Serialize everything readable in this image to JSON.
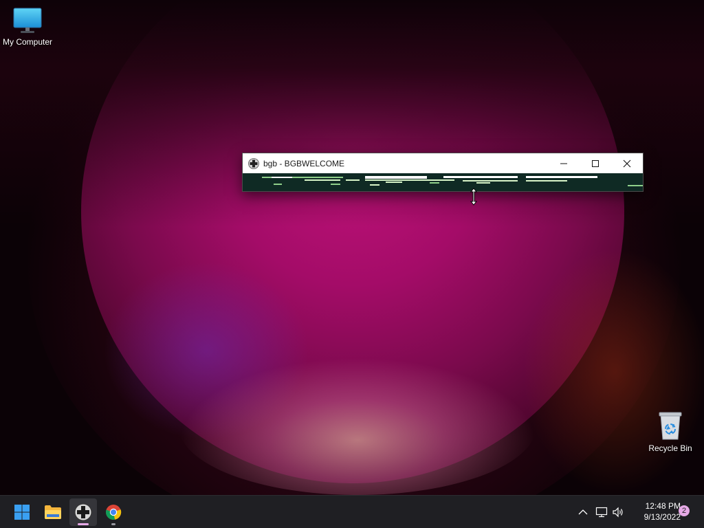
{
  "desktop": {
    "icons": [
      {
        "label": "My Computer",
        "icon": "monitor-icon"
      },
      {
        "label": "Recycle Bin",
        "icon": "recycle-bin-icon"
      }
    ]
  },
  "window": {
    "title": "bgb - BGBWELCOME",
    "icon": "gamepad-dpad-icon",
    "buttons": [
      "minimize-icon",
      "maximize-icon",
      "close-icon"
    ]
  },
  "taskbar": {
    "apps": [
      {
        "name": "Start",
        "icon": "windows-logo-icon"
      },
      {
        "name": "File Explorer",
        "icon": "folder-icon"
      },
      {
        "name": "bgb",
        "icon": "gamepad-dpad-icon",
        "active": true
      },
      {
        "name": "Google Chrome",
        "icon": "chrome-icon"
      }
    ],
    "tray": {
      "icons": [
        "chevron-up-icon",
        "network-icon",
        "volume-icon"
      ],
      "time": "12:48 PM",
      "date": "9/13/2022",
      "notification_count": "2"
    }
  },
  "colors": {
    "taskbar": "#1f1f23",
    "accent": "#e6a9e6",
    "window_client": "#0f2a24"
  }
}
